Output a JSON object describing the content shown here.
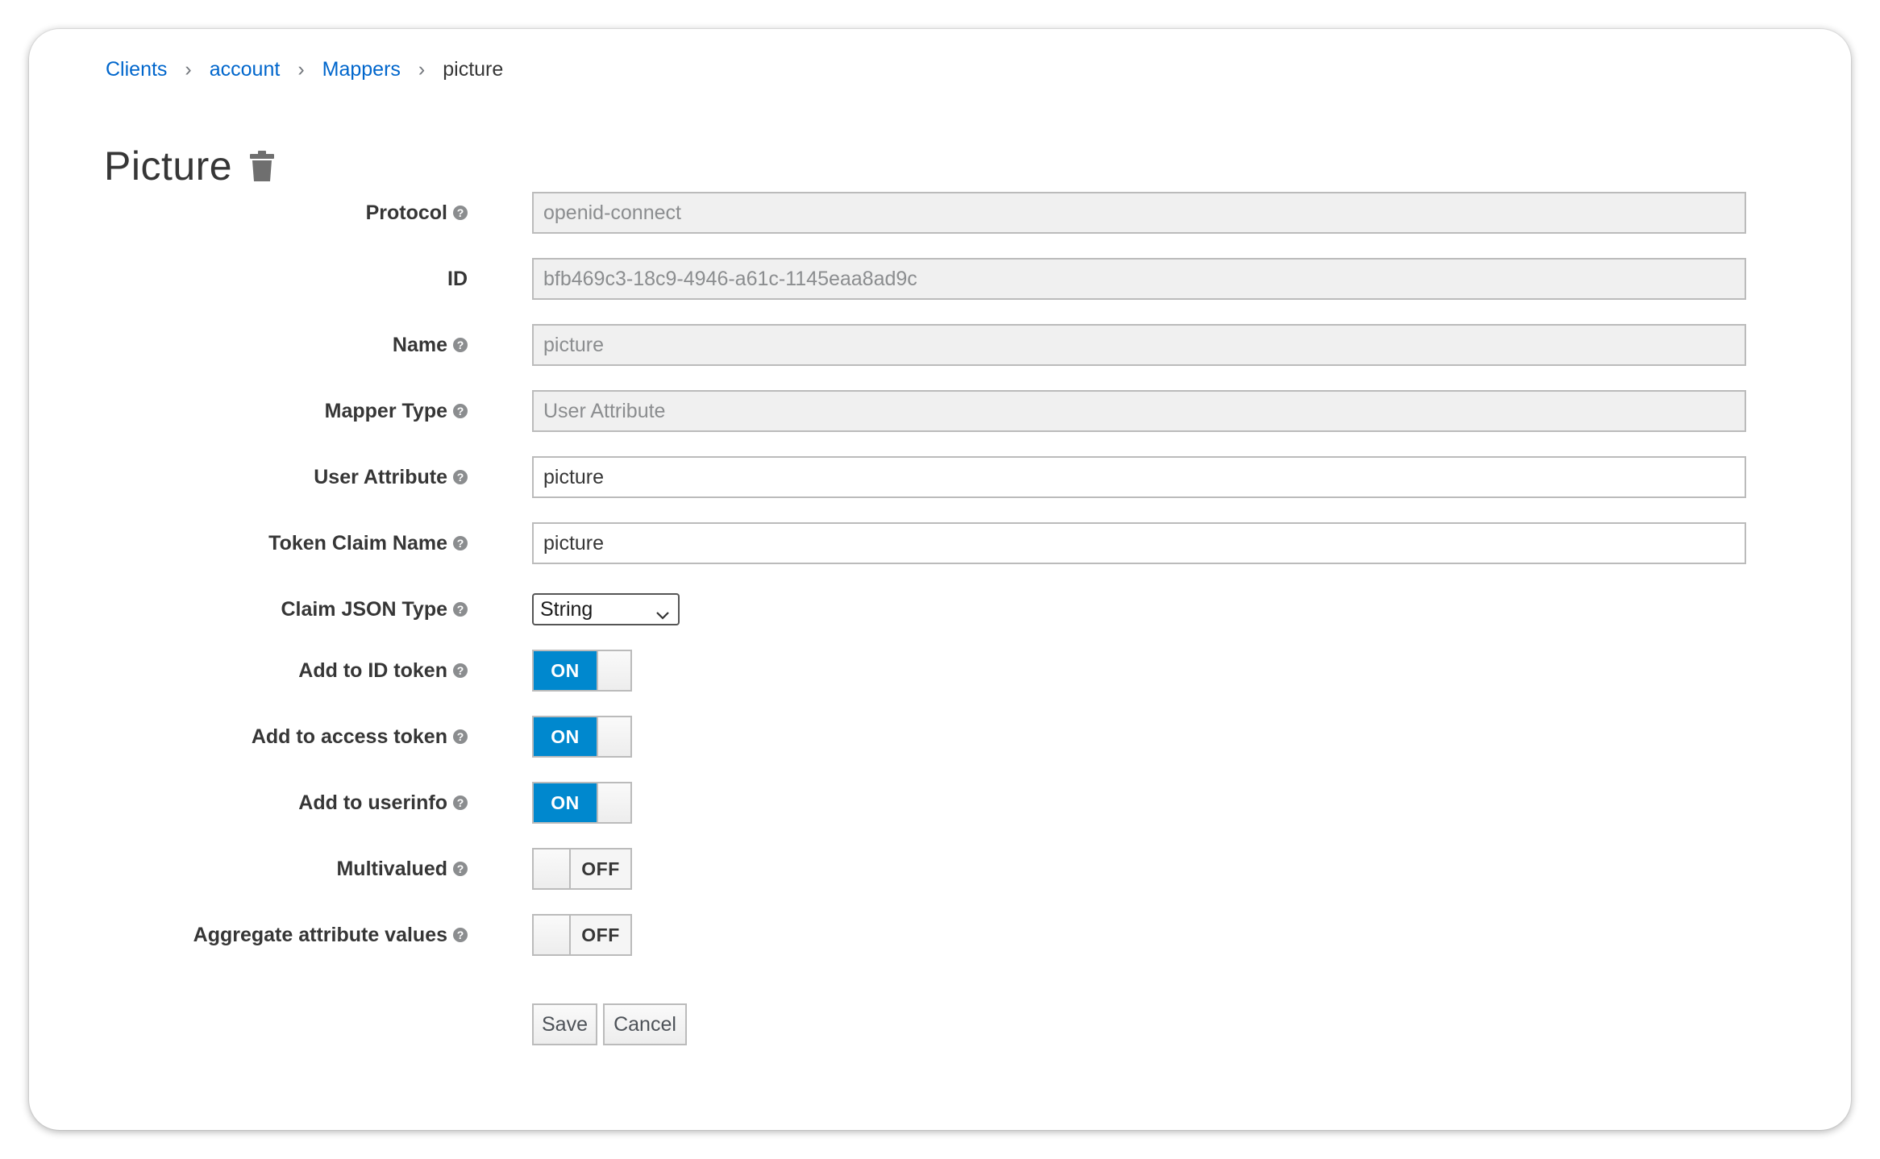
{
  "breadcrumb": {
    "items": [
      "Clients",
      "account",
      "Mappers"
    ],
    "current": "picture",
    "separator": "›"
  },
  "page": {
    "title": "Picture",
    "delete_icon": "trash-icon"
  },
  "form": {
    "protocol": {
      "label": "Protocol",
      "value": "openid-connect"
    },
    "id": {
      "label": "ID",
      "value": "bfb469c3-18c9-4946-a61c-1145eaa8ad9c"
    },
    "name": {
      "label": "Name",
      "value": "picture"
    },
    "mapper_type": {
      "label": "Mapper Type",
      "value": "User Attribute"
    },
    "user_attribute": {
      "label": "User Attribute",
      "value": "picture"
    },
    "token_claim_name": {
      "label": "Token Claim Name",
      "value": "picture"
    },
    "claim_json_type": {
      "label": "Claim JSON Type",
      "selected": "String"
    },
    "add_to_id_token": {
      "label": "Add to ID token",
      "state": "ON"
    },
    "add_to_access_token": {
      "label": "Add to access token",
      "state": "ON"
    },
    "add_to_userinfo": {
      "label": "Add to userinfo",
      "state": "ON"
    },
    "multivalued": {
      "label": "Multivalued",
      "state": "OFF"
    },
    "aggregate_attribute_values": {
      "label": "Aggregate attribute values",
      "state": "OFF"
    }
  },
  "actions": {
    "save_label": "Save",
    "cancel_label": "Cancel"
  },
  "colors": {
    "link": "#0066cc",
    "toggle_on": "#0088ce",
    "readonly_bg": "#f0f0f0"
  }
}
